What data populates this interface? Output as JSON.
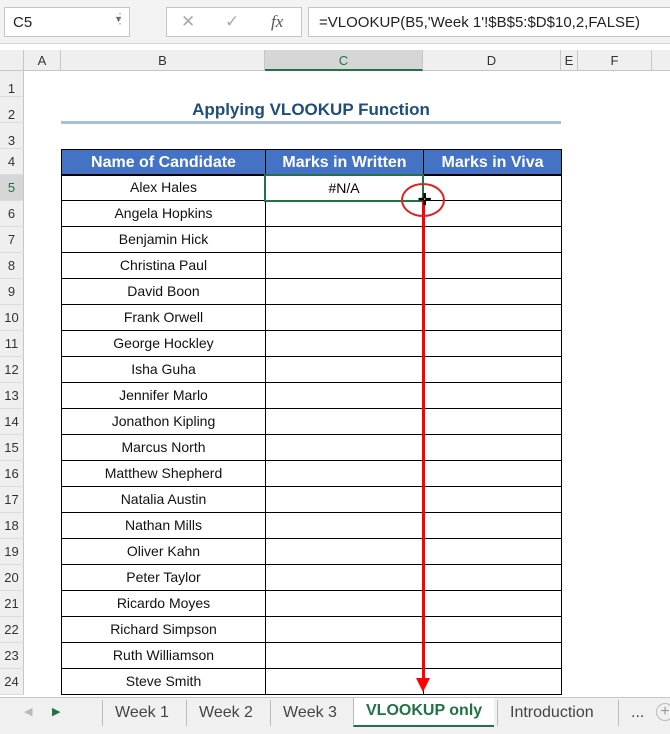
{
  "formula_bar": {
    "name_box": "C5",
    "cancel_icon": "✕",
    "enter_icon": "✓",
    "fx_label": "fx",
    "formula": "=VLOOKUP(B5,'Week 1'!$B$5:$D$10,2,FALSE)"
  },
  "columns": [
    "A",
    "B",
    "C",
    "D",
    "E",
    "F"
  ],
  "rows": [
    "1",
    "2",
    "3",
    "4",
    "5",
    "6",
    "7",
    "8",
    "9",
    "10",
    "11",
    "12",
    "13",
    "14",
    "15",
    "16",
    "17",
    "18",
    "19",
    "20",
    "21",
    "22",
    "23",
    "24"
  ],
  "sheet": {
    "title": "Applying VLOOKUP Function",
    "headers": [
      "Name of Candidate",
      "Marks in Written",
      "Marks in Viva"
    ],
    "names": [
      "Alex Hales",
      "Angela Hopkins",
      "Benjamin Hick",
      "Christina Paul",
      "David Boon",
      "Frank Orwell",
      "George Hockley",
      "Isha Guha",
      "Jennifer Marlo",
      "Jonathon Kipling",
      "Marcus North",
      "Matthew Shepherd",
      "Natalia Austin",
      "Nathan Mills",
      "Oliver Kahn",
      "Peter Taylor",
      "Ricardo Moyes",
      "Richard Simpson",
      "Ruth Williamson",
      "Steve Smith"
    ],
    "c5_value": "#N/A"
  },
  "tabs": {
    "items": [
      "Week 1",
      "Week 2",
      "Week 3",
      "VLOOKUP only",
      "Introduction"
    ],
    "active": "VLOOKUP only",
    "more": "...",
    "add": "+"
  },
  "colors": {
    "header_fill": "#4472c4",
    "title": "#1f4e79",
    "accent": "#217346",
    "annotation": "#ff0000"
  }
}
